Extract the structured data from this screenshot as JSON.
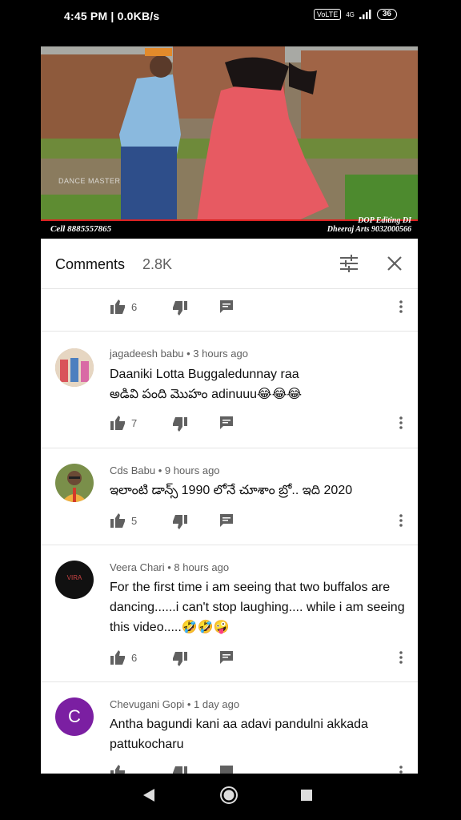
{
  "status_bar": {
    "time": "4:45 PM | 0.0KB/s",
    "volte": "VoLTE",
    "network": "4G",
    "battery": "36"
  },
  "video": {
    "watermark": "DANCE MASTER",
    "cell_caption": "Cell 8885557865",
    "credit_line1": "DOP Editing DI",
    "credit_line2": "Dheeraj Arts  9032000566"
  },
  "comments_panel": {
    "title": "Comments",
    "count": "2.8K",
    "comments": [
      {
        "meta": "",
        "text": "",
        "likes": "6"
      },
      {
        "meta": "jagadeesh babu • 3 hours ago",
        "text": "Daaniki Lotta Buggaledunnay raa\nఅడివి పంది మొహం adinuuu😂😂😂",
        "likes": "7"
      },
      {
        "meta": "Cds Babu • 9 hours ago",
        "text": "ఇలాంటి డాన్స్ 1990 లోనే చూశాం బ్రో.. ఇది 2020",
        "likes": "5"
      },
      {
        "meta": "Veera Chari • 8 hours ago",
        "text": "For the first time i am seeing that two buffalos are dancing......i can't stop laughing.... while i am seeing this video.....🤣🤣🤪",
        "likes": "6",
        "avatar_text": "VIRA"
      },
      {
        "meta": "Chevugani Gopi • 1 day ago",
        "text": "Antha bagundi kani aa adavi pandulni akkada pattukocharu",
        "likes": "",
        "avatar_text": "C"
      }
    ]
  },
  "colors": {
    "purple_avatar": "#7b1fa2",
    "caption_red": "#dd2222"
  }
}
